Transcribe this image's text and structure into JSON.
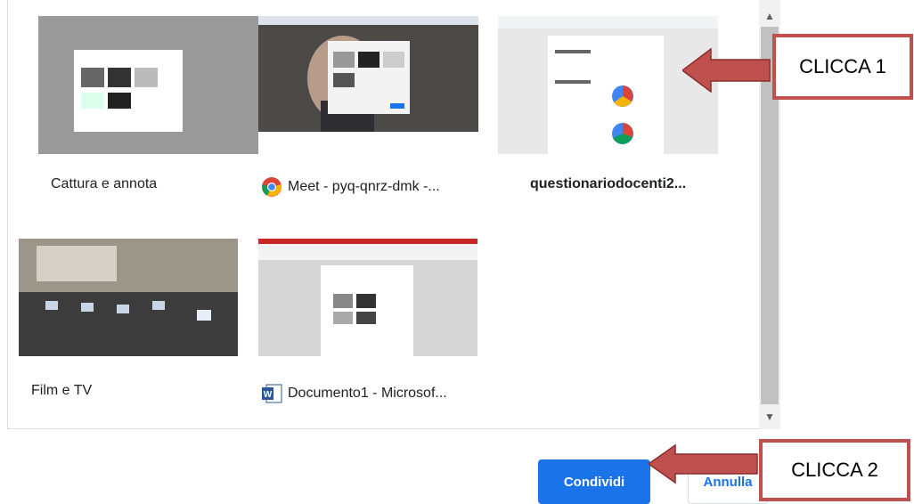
{
  "tiles": [
    {
      "title": "Cattura e annota",
      "icon": "none"
    },
    {
      "title": "Meet - pyq-qnrz-dmk -...",
      "icon": "chrome-icon"
    },
    {
      "title": "questionariodocenti2...",
      "icon": "none"
    },
    {
      "title": "Film e TV",
      "icon": "none"
    },
    {
      "title": "Documento1 - Microsof...",
      "icon": "word-icon"
    }
  ],
  "buttons": {
    "share": "Condividi",
    "cancel": "Annulla"
  },
  "callouts": {
    "first": "CLICCA 1",
    "second": "CLICCA 2"
  },
  "colors": {
    "accent": "#1a73e8",
    "callout_border": "#c0504d",
    "arrow": "#c0504d"
  }
}
